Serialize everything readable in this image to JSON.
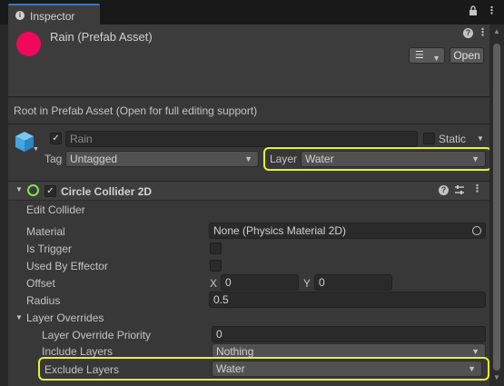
{
  "tab": {
    "title": "Inspector"
  },
  "header": {
    "asset_name": "Rain (Prefab Asset)",
    "open_label": "Open",
    "root_notice": "Root in Prefab Asset (Open for full editing support)"
  },
  "gameobject": {
    "active": true,
    "name_value": "Rain",
    "static_label": "Static",
    "tag_label": "Tag",
    "tag_value": "Untagged",
    "layer_label": "Layer",
    "layer_value": "Water"
  },
  "component": {
    "title": "Circle Collider 2D",
    "enabled": true,
    "edit_collider_label": "Edit Collider",
    "material_label": "Material",
    "material_value": "None (Physics Material 2D)",
    "is_trigger_label": "Is Trigger",
    "used_by_effector_label": "Used By Effector",
    "offset_label": "Offset",
    "offset_x_label": "X",
    "offset_x_value": "0",
    "offset_y_label": "Y",
    "offset_y_value": "0",
    "radius_label": "Radius",
    "radius_value": "0.5",
    "layer_overrides_label": "Layer Overrides",
    "layer_override_priority_label": "Layer Override Priority",
    "layer_override_priority_value": "0",
    "include_layers_label": "Include Layers",
    "include_layers_value": "Nothing",
    "exclude_layers_label": "Exclude Layers",
    "exclude_layers_value": "Water"
  },
  "icons": [
    "info-icon",
    "lock-icon",
    "kebab-menu-icon",
    "help-icon",
    "presets-icon",
    "cube-icon",
    "collider-icon",
    "circle-picker-icon",
    "foldout-arrow-icon",
    "dropdown-arrow-icon"
  ],
  "colors": {
    "highlight": "#eaf326",
    "prefab_dot": "#f0085a",
    "cube_icon": "#44a6e0",
    "collider_icon": "#8be04c",
    "tab_accent": "#3a79bb"
  }
}
